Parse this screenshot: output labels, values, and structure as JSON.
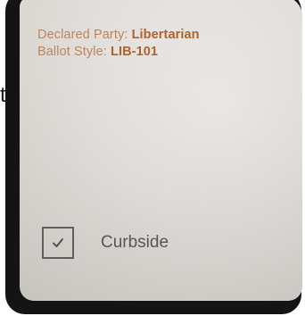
{
  "edge_fragment": "t",
  "voter": {
    "party_label": "Declared Party: ",
    "party_value": "Libertarian",
    "ballot_label": "Ballot Style: ",
    "ballot_value": "LIB-101"
  },
  "curbside": {
    "label": "Curbside",
    "checked": true,
    "check_icon": "checkmark-icon"
  },
  "colors": {
    "info_text": "#b8743e",
    "info_value": "#a8571f",
    "checkbox_border": "#5c5c5c",
    "label_text": "#555555"
  }
}
